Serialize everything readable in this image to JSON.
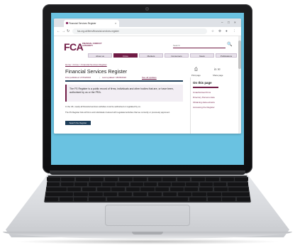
{
  "browser": {
    "tab_title": "Financial Services Register",
    "tab_close": "×",
    "window_controls": [
      "–",
      "□",
      "×"
    ],
    "nav_glyphs": [
      "←",
      "→",
      "↻"
    ],
    "url": "fca.org.uk/firms/financial-services-register",
    "toolbar_icons": [
      "star-icon",
      "extensions-icon",
      "profile-icon",
      "menu-icon"
    ],
    "toolbar_glyphs": [
      "☆",
      "⚙",
      "●",
      "⋮"
    ]
  },
  "page": {
    "logo_mark": "FCA",
    "logo_text": "FINANCIAL CONDUCT AUTHORITY",
    "search_placeholder": "Search",
    "search_glyph": "🔍",
    "nav": [
      "About us",
      "Firms",
      "Markets",
      "Consumers",
      "News",
      "Publications"
    ],
    "nav_active_index": 1,
    "breadcrumb": "Home > Firms > Financial Services Register",
    "title": "Financial Services Register",
    "first_published": "First published: 27/04/2016",
    "last_updated": "Last updated: 18/05/2022",
    "see_all_updates": "See all updates",
    "print_label": "Print page",
    "share_label": "Share page",
    "print_glyph": "⎙",
    "share_glyph": "in ✉",
    "on_this_page": "On this page",
    "on_this_page_items": [
      "Unauthorised firms",
      "Directory Persons data",
      "Obtaining data extracts",
      "Accessing the Register"
    ],
    "callout": "The FS Register is a public record of firms, individuals and other bodies that are, or have been, authorised by us or the PRA.",
    "body_1": "In the UK, nearly all financial services activities must be authorised or regulated by us.",
    "body_2": "The FS Register lists all firms and individuals involved with regulated activities that we currently or previously approved.",
    "cta": "Search the Register"
  },
  "colors": {
    "brand": "#701b45",
    "navy": "#1f3f5a",
    "screen_bg": "#6ac2e1"
  }
}
